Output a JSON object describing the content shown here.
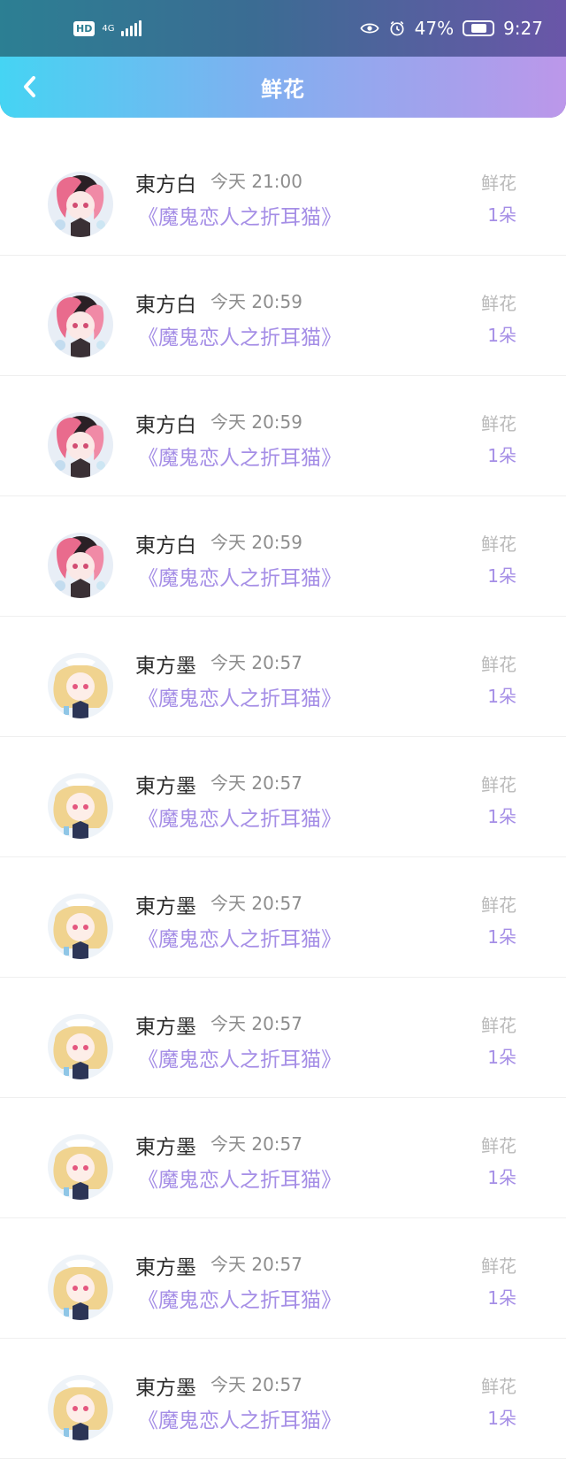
{
  "status_bar": {
    "hd": "HD",
    "network": "4G",
    "battery": "47%",
    "time": "9:27"
  },
  "nav": {
    "title": "鲜花"
  },
  "items": [
    {
      "name": "東方白",
      "time": "今天 21:00",
      "book": "《魔鬼恋人之折耳猫》",
      "gift": "鲜花",
      "count": "1朵",
      "avatar": "pink-hair"
    },
    {
      "name": "東方白",
      "time": "今天 20:59",
      "book": "《魔鬼恋人之折耳猫》",
      "gift": "鲜花",
      "count": "1朵",
      "avatar": "pink-hair"
    },
    {
      "name": "東方白",
      "time": "今天 20:59",
      "book": "《魔鬼恋人之折耳猫》",
      "gift": "鲜花",
      "count": "1朵",
      "avatar": "pink-hair"
    },
    {
      "name": "東方白",
      "time": "今天 20:59",
      "book": "《魔鬼恋人之折耳猫》",
      "gift": "鲜花",
      "count": "1朵",
      "avatar": "pink-hair"
    },
    {
      "name": "東方墨",
      "time": "今天 20:57",
      "book": "《魔鬼恋人之折耳猫》",
      "gift": "鲜花",
      "count": "1朵",
      "avatar": "blonde-hair"
    },
    {
      "name": "東方墨",
      "time": "今天 20:57",
      "book": "《魔鬼恋人之折耳猫》",
      "gift": "鲜花",
      "count": "1朵",
      "avatar": "blonde-hair"
    },
    {
      "name": "東方墨",
      "time": "今天 20:57",
      "book": "《魔鬼恋人之折耳猫》",
      "gift": "鲜花",
      "count": "1朵",
      "avatar": "blonde-hair"
    },
    {
      "name": "東方墨",
      "time": "今天 20:57",
      "book": "《魔鬼恋人之折耳猫》",
      "gift": "鲜花",
      "count": "1朵",
      "avatar": "blonde-hair"
    },
    {
      "name": "東方墨",
      "time": "今天 20:57",
      "book": "《魔鬼恋人之折耳猫》",
      "gift": "鲜花",
      "count": "1朵",
      "avatar": "blonde-hair"
    },
    {
      "name": "東方墨",
      "time": "今天 20:57",
      "book": "《魔鬼恋人之折耳猫》",
      "gift": "鲜花",
      "count": "1朵",
      "avatar": "blonde-hair"
    },
    {
      "name": "東方墨",
      "time": "今天 20:57",
      "book": "《魔鬼恋人之折耳猫》",
      "gift": "鲜花",
      "count": "1朵",
      "avatar": "blonde-hair"
    }
  ]
}
